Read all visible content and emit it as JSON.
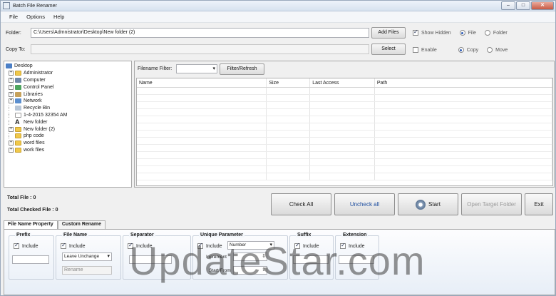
{
  "window": {
    "title": "Batch File Renamer"
  },
  "window_buttons": {
    "minimize": "–",
    "maximize": "□",
    "close": "✕"
  },
  "menu": [
    {
      "label": "File"
    },
    {
      "label": "Options"
    },
    {
      "label": "Help"
    }
  ],
  "folder_row": {
    "label": "Folder:",
    "value": "C:\\Users\\Admnistrator\\Desktop\\New folder (2)",
    "button": "Add Files",
    "show_hidden_label": "Show Hidden",
    "show_hidden_checked": true,
    "file_label": "File",
    "folder_label": "Folder"
  },
  "copyto_row": {
    "label": "Copy To:",
    "value": "",
    "button": "Select",
    "enable_label": "Enable",
    "copy_label": "Copy",
    "move_label": "Move"
  },
  "tree": {
    "root": "Desktop",
    "items": [
      {
        "label": "Administrator",
        "icon": "folder-icon",
        "expandable": true
      },
      {
        "label": "Computer",
        "icon": "computer-icon",
        "expandable": true
      },
      {
        "label": "Control Panel",
        "icon": "control-panel-icon",
        "expandable": true
      },
      {
        "label": "Libraries",
        "icon": "libraries-icon",
        "expandable": true
      },
      {
        "label": "Network",
        "icon": "network-icon",
        "expandable": true
      },
      {
        "label": "Recycle Bin",
        "icon": "recycle-bin-icon",
        "expandable": false
      },
      {
        "label": "1-4-2015 32354 AM",
        "icon": "file-icon",
        "expandable": false
      },
      {
        "label": "New folder",
        "icon": "letter-a-icon",
        "expandable": false
      },
      {
        "label": "New folder (2)",
        "icon": "folder-icon",
        "expandable": true
      },
      {
        "label": "php code",
        "icon": "folder-icon",
        "expandable": false
      },
      {
        "label": "word files",
        "icon": "folder-icon",
        "expandable": true
      },
      {
        "label": "work files",
        "icon": "folder-icon",
        "expandable": true
      }
    ]
  },
  "file_list": {
    "filter_label": "Filename Filter:",
    "filter_button": "Filter/Refresh",
    "columns": [
      "Name",
      "Size",
      "Last Access",
      "Path"
    ]
  },
  "totals": {
    "total_file_label": "Total File :",
    "total_file_value": "0",
    "total_checked_label": "Total Checked File :",
    "total_checked_value": "0"
  },
  "actions": {
    "check_all": "Check All",
    "uncheck_all": "Uncheck all",
    "start": "Start",
    "open_target": "Open Target Folder",
    "exit": "Exit"
  },
  "tabs": [
    {
      "label": "File Name Property"
    },
    {
      "label": "Custom Rename"
    }
  ],
  "props": {
    "prefix": {
      "title": "Prefix",
      "include": "Include"
    },
    "file_name": {
      "title": "File Name",
      "include": "Include",
      "select_value": "Leave Unchange",
      "rename_placeholder": "Rename"
    },
    "separator": {
      "title": "Separator",
      "include": "Include"
    },
    "unique": {
      "title": "Unique Parameter",
      "include": "Include",
      "type_value": "Number",
      "increment_label": "Increment",
      "start_label": "Start From"
    },
    "suffix": {
      "title": "Suffix",
      "include": "Include"
    },
    "extension": {
      "title": "Extension",
      "include": "Include"
    }
  },
  "watermark": "UpdateStar.com",
  "colors": {
    "accent": "#1f4fa0",
    "title_gradient_top": "#eef3fa"
  }
}
